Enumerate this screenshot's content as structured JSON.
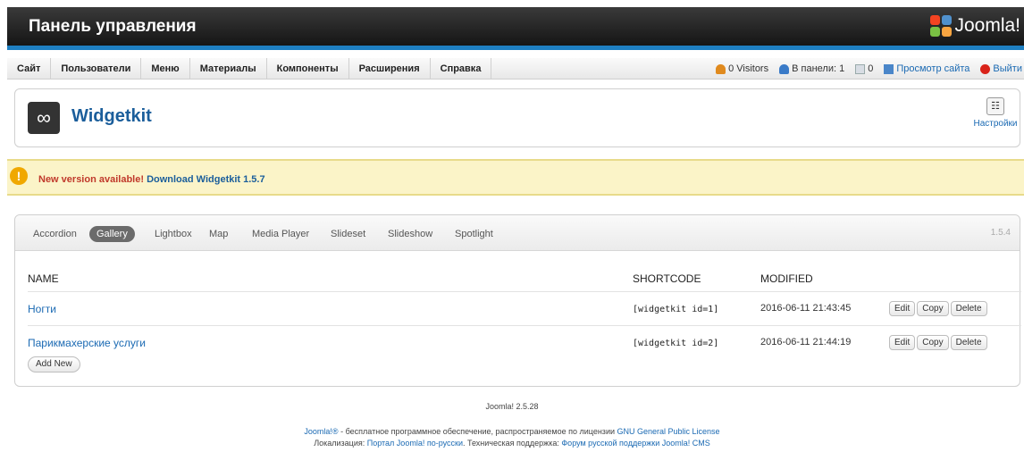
{
  "header": {
    "title": "Панель управления",
    "logo_text": "Joomla!"
  },
  "menu": {
    "items": [
      "Сайт",
      "Пользователи",
      "Меню",
      "Материалы",
      "Компоненты",
      "Расширения",
      "Справка"
    ],
    "visitors": "0 Visitors",
    "in_panel": "В панели: 1",
    "messages": "0",
    "view_site": "Просмотр сайта",
    "logout": "Выйти"
  },
  "app": {
    "title": "Widgetkit",
    "settings_label": "Настройки"
  },
  "notice": {
    "text": "New version available!",
    "link": "Download Widgetkit 1.5.7"
  },
  "widgetkit": {
    "tabs": [
      "Accordion",
      "Gallery",
      "Lightbox",
      "Map",
      "Media Player",
      "Slideset",
      "Slideshow",
      "Spotlight"
    ],
    "active_tab": "Gallery",
    "version": "1.5.4",
    "columns": {
      "name": "NAME",
      "shortcode": "SHORTCODE",
      "modified": "MODIFIED"
    },
    "rows": [
      {
        "name": "Ногти",
        "shortcode": "[widgetkit id=1]",
        "modified": "2016-06-11 21:43:45"
      },
      {
        "name": "Парикмахерские услуги",
        "shortcode": "[widgetkit id=2]",
        "modified": "2016-06-11 21:44:19"
      }
    ],
    "actions": {
      "edit": "Edit",
      "copy": "Copy",
      "delete": "Delete"
    },
    "add_new": "Add New"
  },
  "footer": {
    "version": "Joomla! 2.5.28",
    "line1_a": "Joomla!®",
    "line1_b": " - бесплатное программное обеспечение, распространяемое по лицензии ",
    "line1_link": "GNU General Public License",
    "line2_a": "Локализация: ",
    "line2_link1": "Портал Joomla! по-русски",
    "line2_b": ". Техническая поддержка: ",
    "line2_link2": "Форум русской поддержки Joomla! CMS"
  },
  "colors": {
    "accent": "#1e7fc2",
    "link": "#1b6ab3",
    "notice_bg": "#fbf4c8",
    "notice_text": "#c0392b"
  }
}
